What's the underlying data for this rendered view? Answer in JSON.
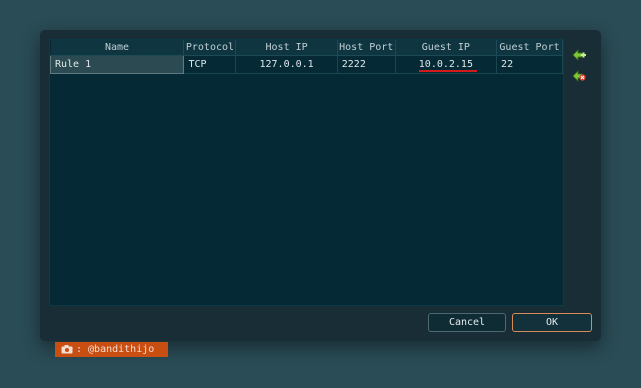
{
  "table": {
    "headers": [
      "Name",
      "Protocol",
      "Host IP",
      "Host Port",
      "Guest IP",
      "Guest Port"
    ],
    "rows": [
      [
        "Rule 1",
        "TCP",
        "127.0.0.1",
        "2222",
        "10.0.2.15",
        "22"
      ]
    ]
  },
  "side_buttons": {
    "add_icon": "add-rule-icon",
    "remove_icon": "remove-rule-icon"
  },
  "buttons": {
    "cancel": "Cancel",
    "ok": "OK"
  },
  "credit": {
    "icon": "camera-icon",
    "text": ": @bandithijo"
  },
  "colors": {
    "accent_red": "#d21a1a",
    "credit_bg": "#c94e12",
    "add_green": "#7ec83a"
  }
}
